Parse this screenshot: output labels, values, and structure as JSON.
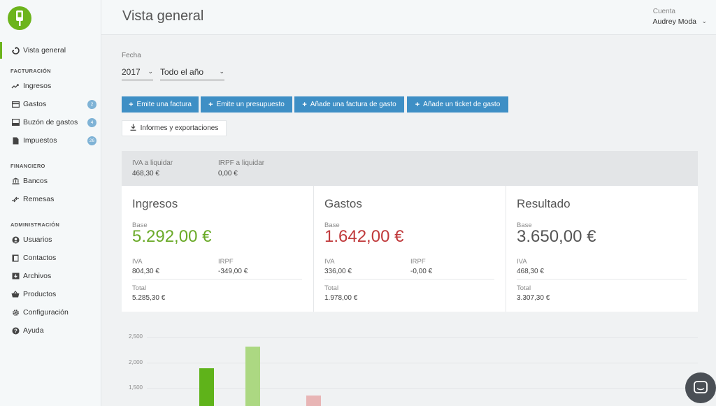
{
  "sidebar": {
    "items": {
      "overview": "Vista general",
      "billing_section": "FACTURACIÓN",
      "ingresos": "Ingresos",
      "gastos": "Gastos",
      "gastos_badge": "2",
      "buzon": "Buzón de gastos",
      "buzon_badge": "4",
      "impuestos": "Impuestos",
      "impuestos_badge": "26",
      "financial_section": "FINANCIERO",
      "bancos": "Bancos",
      "remesas": "Remesas",
      "admin_section": "ADMINISTRACIÓN",
      "usuarios": "Usuarios",
      "contactos": "Contactos",
      "archivos": "Archivos",
      "productos": "Productos",
      "configuracion": "Configuración",
      "ayuda": "Ayuda"
    }
  },
  "header": {
    "title": "Vista general",
    "account_label": "Cuenta",
    "account_name": "Audrey Moda"
  },
  "filters": {
    "date_label": "Fecha",
    "year": "2017",
    "period": "Todo el año"
  },
  "actions": {
    "emit_invoice": "Emite una factura",
    "emit_quote": "Emite un presupuesto",
    "add_expense_invoice": "Añade una factura de gasto",
    "add_expense_ticket": "Añade un ticket de gasto",
    "reports": "Informes y exportaciones"
  },
  "taxes": {
    "iva_label": "IVA a liquidar",
    "iva_value": "468,30 €",
    "irpf_label": "IRPF a liquidar",
    "irpf_value": "0,00 €"
  },
  "cards": {
    "ingresos": {
      "title": "Ingresos",
      "base_label": "Base",
      "base": "5.292,00 €",
      "iva_label": "IVA",
      "iva": "804,30 €",
      "irpf_label": "IRPF",
      "irpf": "-349,00 €",
      "total_label": "Total",
      "total": "5.285,30 €"
    },
    "gastos": {
      "title": "Gastos",
      "base_label": "Base",
      "base": "1.642,00 €",
      "iva_label": "IVA",
      "iva": "336,00 €",
      "irpf_label": "IRPF",
      "irpf": "-0,00 €",
      "total_label": "Total",
      "total": "1.978,00 €"
    },
    "resultado": {
      "title": "Resultado",
      "base_label": "Base",
      "base": "3.650,00 €",
      "iva_label": "IVA",
      "iva": "468,30 €",
      "total_label": "Total",
      "total": "3.307,30 €"
    }
  },
  "colors": {
    "accent_green": "#6cb41c",
    "ingresos_green": "#6aaa28",
    "gastos_red": "#c0393b",
    "button_blue": "#3e8fc5"
  },
  "chart_data": {
    "type": "bar",
    "yticks": [
      "2,500",
      "2,000",
      "1,500"
    ],
    "ylim": [
      1200,
      2500
    ],
    "series": [
      {
        "x_index": 0,
        "value": 1880,
        "color": "#5fb31a"
      },
      {
        "x_index": 1,
        "value": 2310,
        "color": "#acd882"
      },
      {
        "x_index": 2,
        "value": 1350,
        "color": "#e8b5b5"
      }
    ]
  }
}
